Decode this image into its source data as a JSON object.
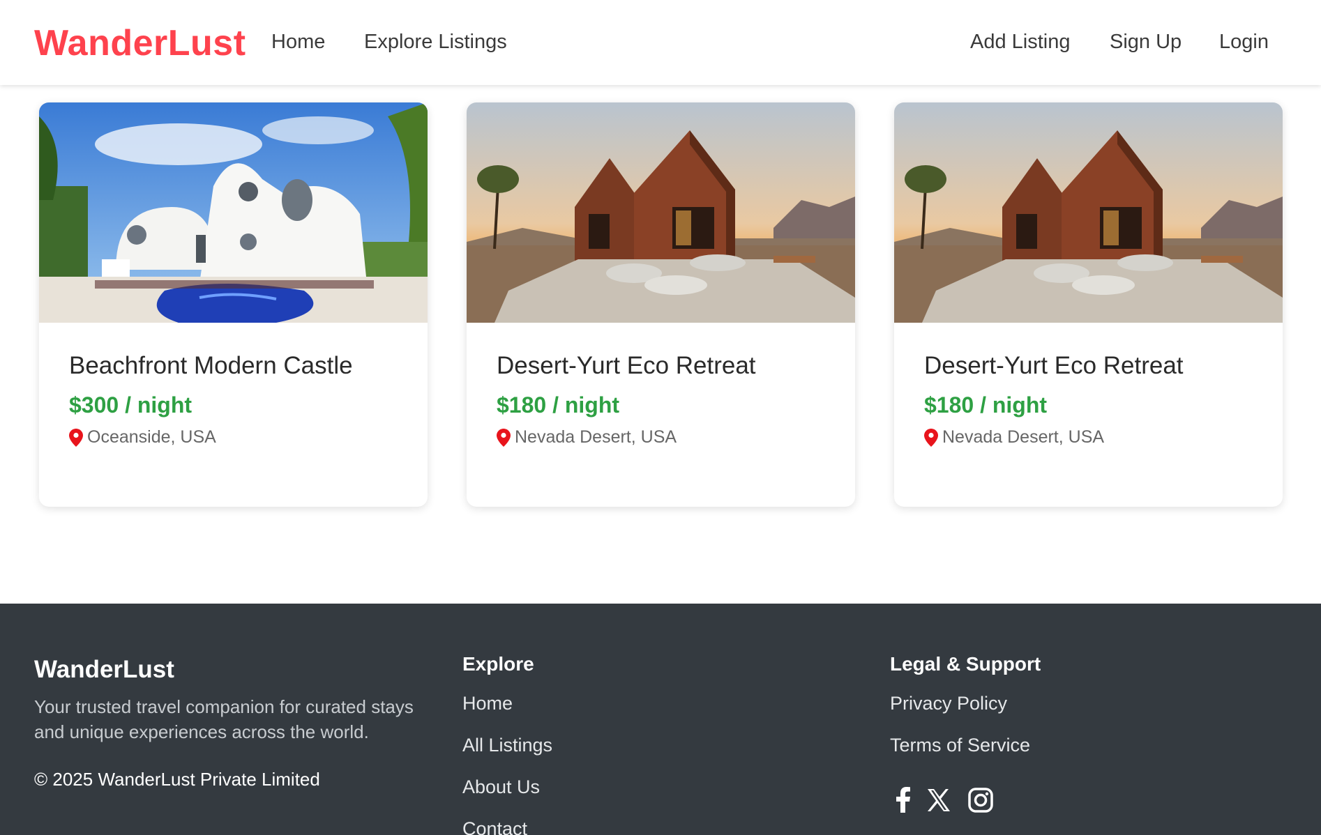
{
  "nav": {
    "brand": "WanderLust",
    "links": [
      "Home",
      "Explore Listings"
    ],
    "right_links": [
      "Add Listing",
      "Sign Up",
      "Login"
    ],
    "brand_color": "#fe424d"
  },
  "listings": [
    {
      "title": "Beachfront Modern Castle",
      "price": "$300 / night",
      "location": "Oceanside, USA",
      "image": "seashell-house-photo"
    },
    {
      "title": "Desert-Yurt Eco Retreat",
      "price": "$180 / night",
      "location": "Nevada Desert, USA",
      "image": "desert-cabins-photo"
    },
    {
      "title": "Desert-Yurt Eco Retreat",
      "price": "$180 / night",
      "location": "Nevada Desert, USA",
      "image": "desert-cabins-photo"
    }
  ],
  "footer": {
    "brand": "WanderLust",
    "tagline": "Your trusted travel companion for curated stays and unique experiences across the world.",
    "copyright": "© 2025 WanderLust Private Limited",
    "explore": {
      "heading": "Explore",
      "links": [
        "Home",
        "All Listings",
        "About Us",
        "Contact"
      ]
    },
    "legal": {
      "heading": "Legal & Support",
      "links": [
        "Privacy Policy",
        "Terms of Service"
      ]
    },
    "social_icons": [
      "facebook-icon",
      "x-icon",
      "instagram-icon"
    ]
  },
  "colors": {
    "price": "#2ea043",
    "pin": "#e8141c",
    "footer_bg": "#343a40"
  }
}
